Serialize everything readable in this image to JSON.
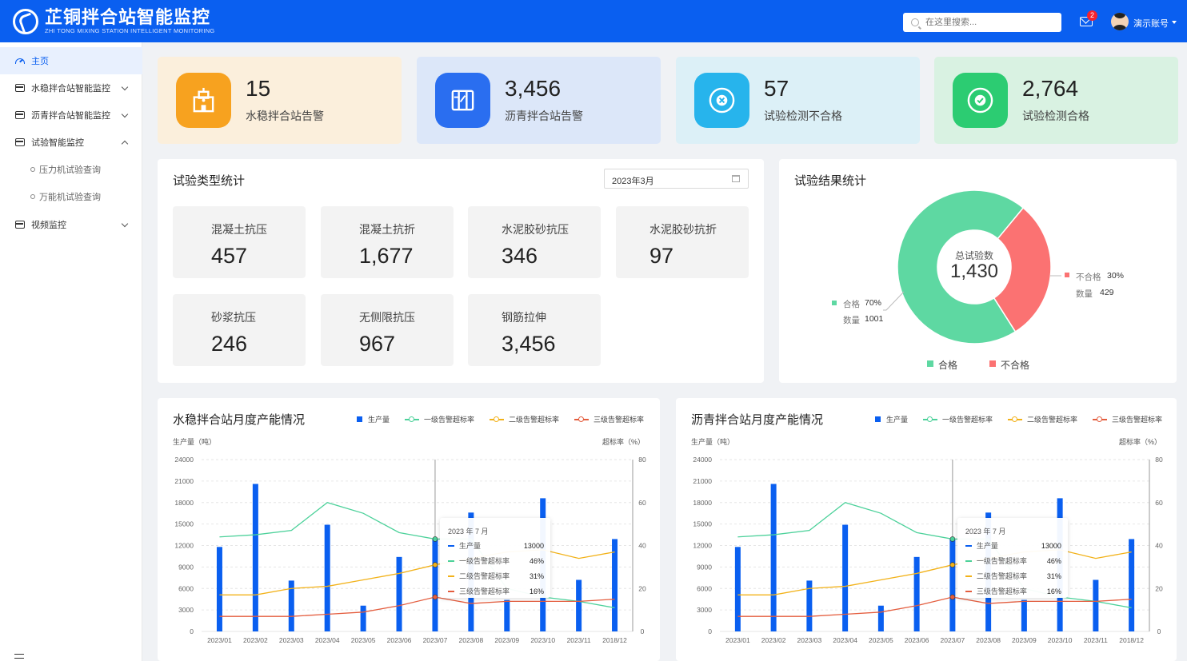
{
  "header": {
    "title": "芷铜拌合站智能监控",
    "subtitle": "ZHI TONG MIXING STATION INTELLIGENT MONITORING",
    "search_placeholder": "在这里搜索...",
    "mail_icon": "mail-icon",
    "notification_count": "2",
    "account_label": "演示账号"
  },
  "sidebar": {
    "items": [
      {
        "label": "主页",
        "icon": "dashboard-icon",
        "active": true
      },
      {
        "label": "水稳拌合站智能监控",
        "icon": "server-icon",
        "expanded": false
      },
      {
        "label": "沥青拌合站智能监控",
        "icon": "server-icon",
        "expanded": false
      },
      {
        "label": "试验智能监控",
        "icon": "server-icon",
        "expanded": true
      },
      {
        "label": "视频监控",
        "icon": "server-icon",
        "expanded": false
      }
    ],
    "sub_items": [
      "压力机试验查询",
      "万能机试验查询"
    ]
  },
  "stats": [
    {
      "value": "15",
      "label": "水稳拌合站告警",
      "icon": "building-icon",
      "bg": "#fbefdc",
      "icon_color": "#f7a21f"
    },
    {
      "value": "3,456",
      "label": "沥青拌合站告警",
      "icon": "book-icon",
      "bg": "#dce7f9",
      "icon_color": "#2a6ef0"
    },
    {
      "value": "57",
      "label": "试验检测不合格",
      "icon": "cross-circle-icon",
      "bg": "#dcf0f7",
      "icon_color": "#27b4ec"
    },
    {
      "value": "2,764",
      "label": "试验检测合格",
      "icon": "check-circle-icon",
      "bg": "#d9f2e2",
      "icon_color": "#2ccc72"
    }
  ],
  "test_types": {
    "title": "试验类型统计",
    "date_value": "2023年3月",
    "tiles": [
      {
        "name": "混凝土抗压",
        "value": "457"
      },
      {
        "name": "混凝土抗折",
        "value": "1,677"
      },
      {
        "name": "水泥胶砂抗压",
        "value": "346"
      },
      {
        "name": "水泥胶砂抗折",
        "value": "97"
      },
      {
        "name": "砂浆抗压",
        "value": "246"
      },
      {
        "name": "无侧限抗压",
        "value": "967"
      },
      {
        "name": "钢筋拉伸",
        "value": "3,456"
      }
    ]
  },
  "results": {
    "title": "试验结果统计",
    "center_label": "总试验数",
    "center_value": "1,430",
    "pass_label": "合格",
    "pass_pct": "70%",
    "pass_count_label": "数量",
    "pass_count": "1001",
    "fail_label": "不合格",
    "fail_pct": "30%",
    "fail_count_label": "数量",
    "fail_count": "429",
    "pass_color": "#5ed8a2",
    "fail_color": "#fb7272",
    "chart_data": {
      "type": "pie",
      "categories": [
        "合格",
        "不合格"
      ],
      "values": [
        1001,
        429
      ]
    }
  },
  "charts": [
    {
      "title": "水稳拌合站月度产能情况",
      "ylabel_left": "生产量（吨）",
      "ylabel_right": "超标率（%）",
      "legend": [
        "生产量",
        "一级告警超标率",
        "二级告警超标率",
        "三级告警超标率"
      ],
      "tooltip": {
        "title": "2023 年 7 月",
        "rows": [
          {
            "name": "生产量",
            "value": "13000"
          },
          {
            "name": "一级告警超标率",
            "value": "46%"
          },
          {
            "name": "二级告警超标率",
            "value": "31%"
          },
          {
            "name": "三级告警超标率",
            "value": "16%"
          }
        ]
      }
    },
    {
      "title": "沥青拌合站月度产能情况",
      "ylabel_left": "生产量（吨）",
      "ylabel_right": "超标率（%）",
      "legend": [
        "生产量",
        "一级告警超标率",
        "二级告警超标率",
        "三级告警超标率"
      ],
      "tooltip": {
        "title": "2023 年 7 月",
        "rows": [
          {
            "name": "生产量",
            "value": "13000"
          },
          {
            "name": "一级告警超标率",
            "value": "46%"
          },
          {
            "name": "二级告警超标率",
            "value": "31%"
          },
          {
            "name": "三级告警超标率",
            "value": "16%"
          }
        ]
      }
    }
  ],
  "chart_data": [
    {
      "type": "bar",
      "categories": [
        "2023/01",
        "2023/02",
        "2023/03",
        "2023/04",
        "2023/05",
        "2023/06",
        "2023/07",
        "2023/08",
        "2023/09",
        "2023/10",
        "2023/11",
        "2018/12"
      ],
      "y_left": {
        "min": 0,
        "max": 24000,
        "ticks": [
          0,
          3000,
          6000,
          9000,
          12000,
          15000,
          18000,
          21000,
          24000
        ]
      },
      "y_right": {
        "min": 0,
        "max": 80,
        "ticks": [
          0,
          20,
          40,
          60,
          80
        ]
      },
      "series": [
        {
          "name": "生产量",
          "axis": "left",
          "kind": "bar",
          "color": "#0a5ff0",
          "values": [
            11800,
            20600,
            7100,
            14900,
            3600,
            10400,
            13000,
            16600,
            4400,
            18600,
            7200,
            12900
          ]
        },
        {
          "name": "一级告警超标率",
          "axis": "right",
          "kind": "line",
          "color": "#4cd19a",
          "values": [
            44,
            45,
            47,
            60,
            55,
            46,
            43,
            43,
            20,
            16,
            14,
            11
          ]
        },
        {
          "name": "二级告警超标率",
          "axis": "right",
          "kind": "line",
          "color": "#f2b21a",
          "values": [
            17,
            17,
            20,
            21,
            24,
            27,
            31,
            34,
            37,
            38,
            34,
            37
          ]
        },
        {
          "name": "三级告警超标率",
          "axis": "right",
          "kind": "line",
          "color": "#e45d3e",
          "values": [
            7,
            7,
            7,
            8,
            9,
            12,
            16,
            13,
            14,
            14,
            14,
            15
          ]
        }
      ]
    },
    {
      "type": "bar",
      "categories": [
        "2023/01",
        "2023/02",
        "2023/03",
        "2023/04",
        "2023/05",
        "2023/06",
        "2023/07",
        "2023/08",
        "2023/09",
        "2023/10",
        "2023/11",
        "2018/12"
      ],
      "y_left": {
        "min": 0,
        "max": 24000,
        "ticks": [
          0,
          3000,
          6000,
          9000,
          12000,
          15000,
          18000,
          21000,
          24000
        ]
      },
      "y_right": {
        "min": 0,
        "max": 80,
        "ticks": [
          0,
          20,
          40,
          60,
          80
        ]
      },
      "series": [
        {
          "name": "生产量",
          "axis": "left",
          "kind": "bar",
          "color": "#0a5ff0",
          "values": [
            11800,
            20600,
            7100,
            14900,
            3600,
            10400,
            13000,
            16600,
            4400,
            18600,
            7200,
            12900
          ]
        },
        {
          "name": "一级告警超标率",
          "axis": "right",
          "kind": "line",
          "color": "#4cd19a",
          "values": [
            44,
            45,
            47,
            60,
            55,
            46,
            43,
            43,
            20,
            16,
            14,
            11
          ]
        },
        {
          "name": "二级告警超标率",
          "axis": "right",
          "kind": "line",
          "color": "#f2b21a",
          "values": [
            17,
            17,
            20,
            21,
            24,
            27,
            31,
            34,
            37,
            38,
            34,
            37
          ]
        },
        {
          "name": "三级告警超标率",
          "axis": "right",
          "kind": "line",
          "color": "#e45d3e",
          "values": [
            7,
            7,
            7,
            8,
            9,
            12,
            16,
            13,
            14,
            14,
            14,
            15
          ]
        }
      ]
    }
  ]
}
